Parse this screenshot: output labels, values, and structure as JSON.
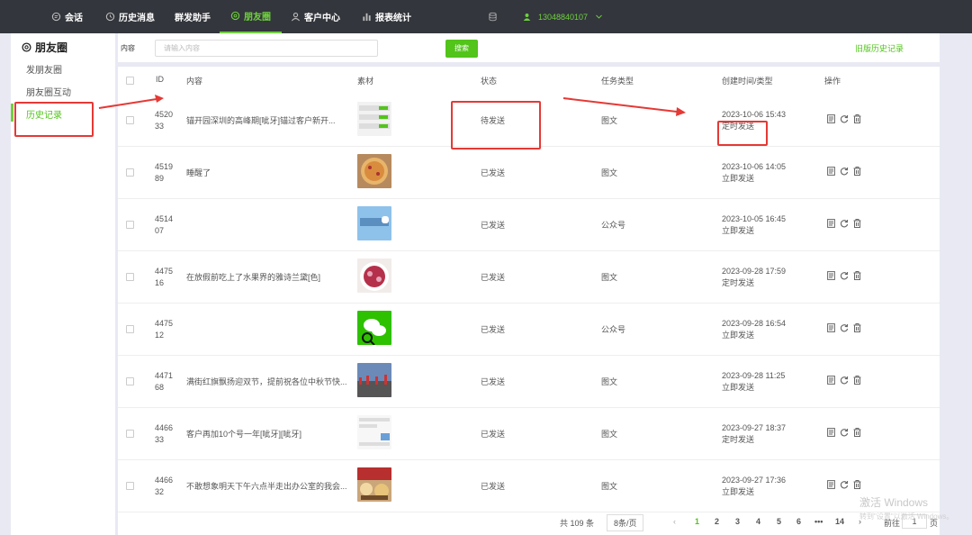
{
  "nav": [
    {
      "label": "会话",
      "icon": "chat-icon"
    },
    {
      "label": "历史消息",
      "icon": "clock-icon"
    },
    {
      "label": "群发助手",
      "icon": ""
    },
    {
      "label": "朋友圈",
      "icon": "moments-icon"
    },
    {
      "label": "客户中心",
      "icon": "user-icon"
    },
    {
      "label": "报表统计",
      "icon": "bar-chart-icon"
    }
  ],
  "user": {
    "phone": "13048840107",
    "status_color": "#6fd13f"
  },
  "sidebar": {
    "title": "朋友圈",
    "items": [
      {
        "label": "发朋友圈"
      },
      {
        "label": "朋友圈互动"
      },
      {
        "label": "历史记录"
      }
    ]
  },
  "search": {
    "label": "内容",
    "placeholder": "请输入内容",
    "button": "搜索",
    "old_history": "旧版历史记录"
  },
  "table": {
    "headers": [
      "ID",
      "内容",
      "素材",
      "状态",
      "任务类型",
      "创建时间/类型",
      "操作"
    ],
    "rows": [
      {
        "id1": "4520",
        "id2": "33",
        "content": "锚开园深圳的高峰期[呲牙]锚过客户新开...",
        "status": "待发送",
        "type": "图文",
        "time": "2023-10-06 15:43",
        "mode": "定时发送",
        "thumb": "screenshot"
      },
      {
        "id1": "4519",
        "id2": "89",
        "content": "睡醒了",
        "status": "已发送",
        "type": "图文",
        "time": "2023-10-06 14:05",
        "mode": "立即发送",
        "thumb": "pizza"
      },
      {
        "id1": "4514",
        "id2": "07",
        "content": "",
        "status": "已发送",
        "type": "公众号",
        "time": "2023-10-05 16:45",
        "mode": "立即发送",
        "thumb": "blue"
      },
      {
        "id1": "4475",
        "id2": "16",
        "content": "在放假前吃上了水果界的雅诗兰黛[色]",
        "status": "已发送",
        "type": "图文",
        "time": "2023-09-28 17:59",
        "mode": "定时发送",
        "thumb": "fruit"
      },
      {
        "id1": "4475",
        "id2": "12",
        "content": "",
        "status": "已发送",
        "type": "公众号",
        "time": "2023-09-28 16:54",
        "mode": "立即发送",
        "thumb": "wechat"
      },
      {
        "id1": "4471",
        "id2": "68",
        "content": "满街红旗飘扬迎双节，提前祝各位中秋节快...",
        "status": "已发送",
        "type": "图文",
        "time": "2023-09-28 11:25",
        "mode": "立即发送",
        "thumb": "city"
      },
      {
        "id1": "4466",
        "id2": "33",
        "content": "客户再加10个号一年[呲牙][呲牙]",
        "status": "已发送",
        "type": "图文",
        "time": "2023-09-27 18:37",
        "mode": "定时发送",
        "thumb": "screenshot2"
      },
      {
        "id1": "4466",
        "id2": "32",
        "content": "不敢想象明天下午六点半走出办公室的我会...",
        "status": "已发送",
        "type": "图文",
        "time": "2023-09-27 17:36",
        "mode": "立即发送",
        "thumb": "food"
      }
    ]
  },
  "pager": {
    "total": "共 109 条",
    "size": "8条/页",
    "pages": [
      "1",
      "2",
      "3",
      "4",
      "5",
      "6",
      "•••",
      "14"
    ],
    "goto": "前往",
    "goto_value": "1",
    "page_suffix": "页",
    "prev": "‹",
    "next": "›"
  },
  "watermark": {
    "line1": "激活 Windows",
    "line2": "转到\"设置\"以激活 Windows。"
  },
  "colors": {
    "brand": "#52c41a",
    "topbar": "#33363c",
    "annotation": "#e53935"
  }
}
